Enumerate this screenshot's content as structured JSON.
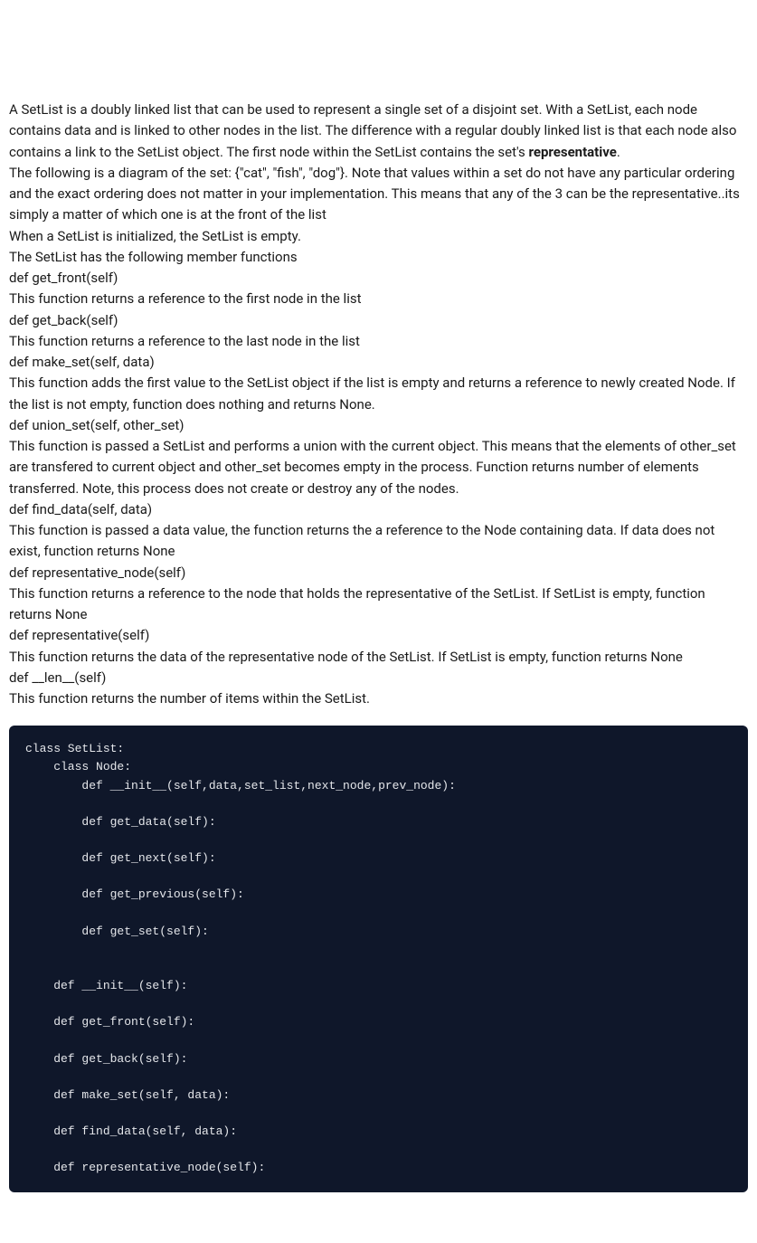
{
  "intro": {
    "p1a": "A SetList is a doubly linked list that can be used to represent a single set of a disjoint set. With a SetList, each node contains data and is linked to other nodes in the list. The difference with a regular doubly linked list is that each node also contains a link to the SetList object. The first node within the SetList contains the set's ",
    "p1b_bold": "representative",
    "p1c": ".",
    "p2": "The following is a diagram of the set: {\"cat\", \"fish\", \"dog\"}. Note that values within a set do not have any particular ordering and the exact ordering does not matter in your implementation. This means that any of the 3 can be the representative..its simply a matter of which one is at the front of the list",
    "p3": "When a SetList is initialized, the SetList is empty.",
    "p4": "The SetList has the following member functions"
  },
  "functions": [
    {
      "sig": "def get_front(self)",
      "desc": "This function returns a reference to the first node in the list"
    },
    {
      "sig": "def get_back(self)",
      "desc": "This function returns a reference to the last node in the list"
    },
    {
      "sig": "def make_set(self, data)",
      "desc": "This function adds the first value to the SetList object if the list is empty and returns a reference to newly created Node. If the list is not empty, function does nothing and returns None."
    },
    {
      "sig": "def union_set(self, other_set)",
      "desc": "This function is passed a SetList and performs a union with the current object. This means that the elements of other_set are transfered to current object and other_set becomes empty in the process. Function returns number of elements transferred. Note, this process does not create or destroy any of the nodes."
    },
    {
      "sig": "def find_data(self, data)",
      "desc": "This function is passed a data value, the function returns the a reference to the Node containing data. If data does not exist, function returns None"
    },
    {
      "sig": "def representative_node(self)",
      "desc": "This function returns a reference to the node that holds the representative of the SetList. If SetList is empty, function returns None"
    },
    {
      "sig": "def representative(self)",
      "desc": "This function returns the data of the representative node of the SetList. If SetList is empty, function returns None"
    },
    {
      "sig": "def __len__(self)",
      "desc": "This function returns the number of items within the SetList."
    }
  ],
  "code": "class SetList:\n    class Node:\n        def __init__(self,data,set_list,next_node,prev_node):\n\n        def get_data(self):\n\n        def get_next(self):\n\n        def get_previous(self):\n\n        def get_set(self):\n\n\n    def __init__(self):\n\n    def get_front(self):\n\n    def get_back(self):\n\n    def make_set(self, data):\n\n    def find_data(self, data):\n\n    def representative_node(self):\n"
}
